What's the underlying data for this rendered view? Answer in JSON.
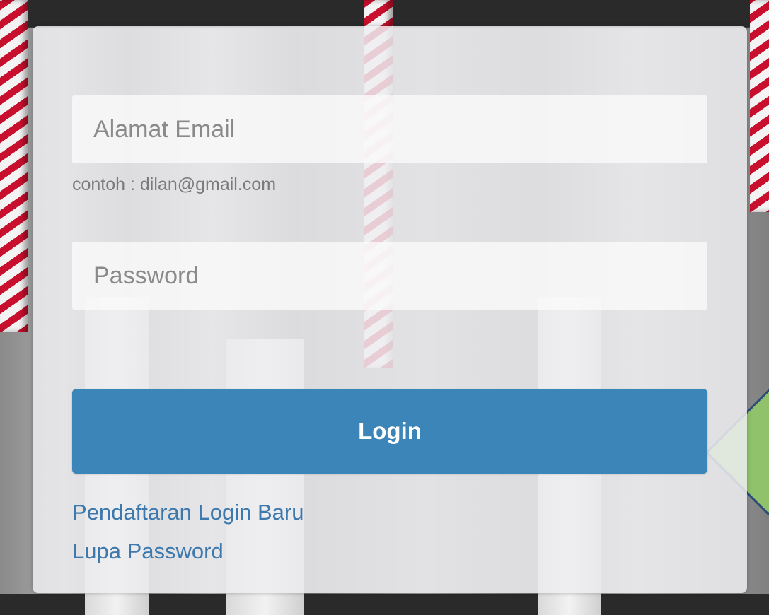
{
  "login_form": {
    "email_placeholder": "Alamat Email",
    "email_value": "",
    "email_hint": "contoh : dilan@gmail.com",
    "password_placeholder": "Password",
    "password_value": "",
    "login_button_label": "Login",
    "register_link_label": "Pendaftaran Login Baru",
    "forgot_password_link_label": "Lupa Password"
  },
  "colors": {
    "primary_button": "#3b85b8",
    "link": "#3d79ad",
    "card_background": "#eeeef0"
  }
}
